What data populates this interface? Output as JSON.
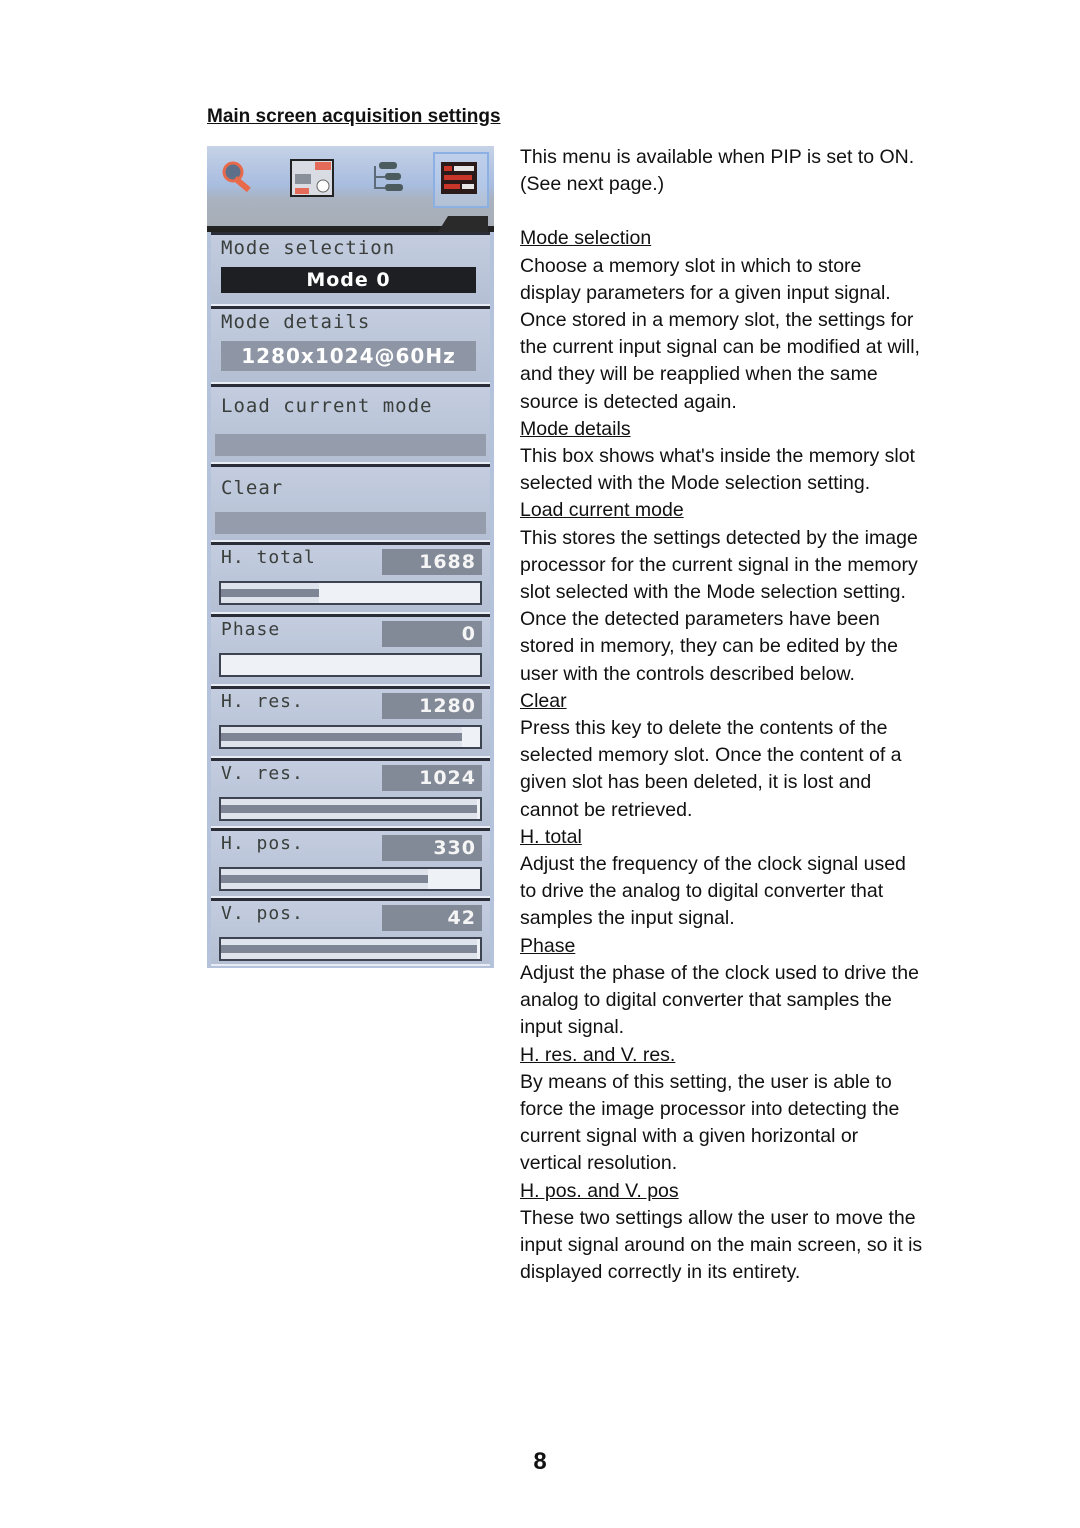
{
  "title": "Main screen acquisition settings",
  "osd": {
    "tabs": [
      {
        "name": "wrench-tool",
        "active": false
      },
      {
        "name": "picture-in-picture",
        "active": false
      },
      {
        "name": "signal-tree",
        "active": false
      },
      {
        "name": "acquisition-settings",
        "active": true
      }
    ],
    "mode_selection": {
      "label": "Mode selection",
      "value": "Mode 0"
    },
    "mode_details": {
      "label": "Mode details",
      "value": "1280x1024@60Hz"
    },
    "load_current_mode": {
      "label": "Load current mode"
    },
    "clear": {
      "label": "Clear"
    },
    "sliders": [
      {
        "label": "H. total",
        "value": "1688",
        "fill_percent": 38
      },
      {
        "label": "Phase",
        "value": "0",
        "fill_percent": 0
      },
      {
        "label": "H. res.",
        "value": "1280",
        "fill_percent": 93
      },
      {
        "label": "V. res.",
        "value": "1024",
        "fill_percent": 99
      },
      {
        "label": "H. pos.",
        "value": "330",
        "fill_percent": 80
      },
      {
        "label": "V. pos.",
        "value": "42",
        "fill_percent": 99
      }
    ]
  },
  "description": {
    "intro_1": "This menu is available when PIP is set to ON.",
    "intro_2": "(See next page.)",
    "sections": [
      {
        "heading": "Mode selection",
        "lines": [
          "Choose a memory slot in which to store",
          "display parameters for a given input signal.",
          "Once stored in a memory slot, the settings for",
          "the current input signal can be modified at will,",
          "and they will be reapplied when the same",
          "source is detected again."
        ]
      },
      {
        "heading": "Mode details",
        "lines": [
          "This box shows what's inside the memory slot",
          "selected with the Mode selection setting."
        ]
      },
      {
        "heading": "Load current mode",
        "lines": [
          "This stores the settings detected by the image",
          "processor for the current signal in the memory",
          "slot selected with the Mode selection setting.",
          "Once the detected parameters have been",
          "stored in memory, they can be edited by the",
          "user with the controls described below."
        ]
      },
      {
        "heading": "Clear",
        "lines": [
          "Press this key to delete the contents of the",
          "selected memory slot. Once the content of a",
          "given slot has been deleted, it is lost and",
          "cannot be retrieved."
        ]
      },
      {
        "heading": "H. total",
        "lines": [
          "Adjust the frequency of the clock signal used",
          "to drive the analog to digital converter that",
          "samples the input signal."
        ]
      },
      {
        "heading": "Phase",
        "lines": [
          "Adjust the phase of the clock used to drive the",
          "analog to digital converter that samples the",
          "input signal."
        ]
      },
      {
        "heading": "H. res. and V. res.",
        "lines": [
          "By means of this setting, the user is able to",
          "force the image processor into detecting the",
          "current signal with a given horizontal or",
          "vertical resolution."
        ]
      },
      {
        "heading": "H. pos. and V. pos",
        "lines": [
          "These two settings allow the user to move the",
          "input signal around on the main screen, so it is",
          "displayed correctly in its entirety."
        ]
      }
    ]
  },
  "page_number": "8"
}
